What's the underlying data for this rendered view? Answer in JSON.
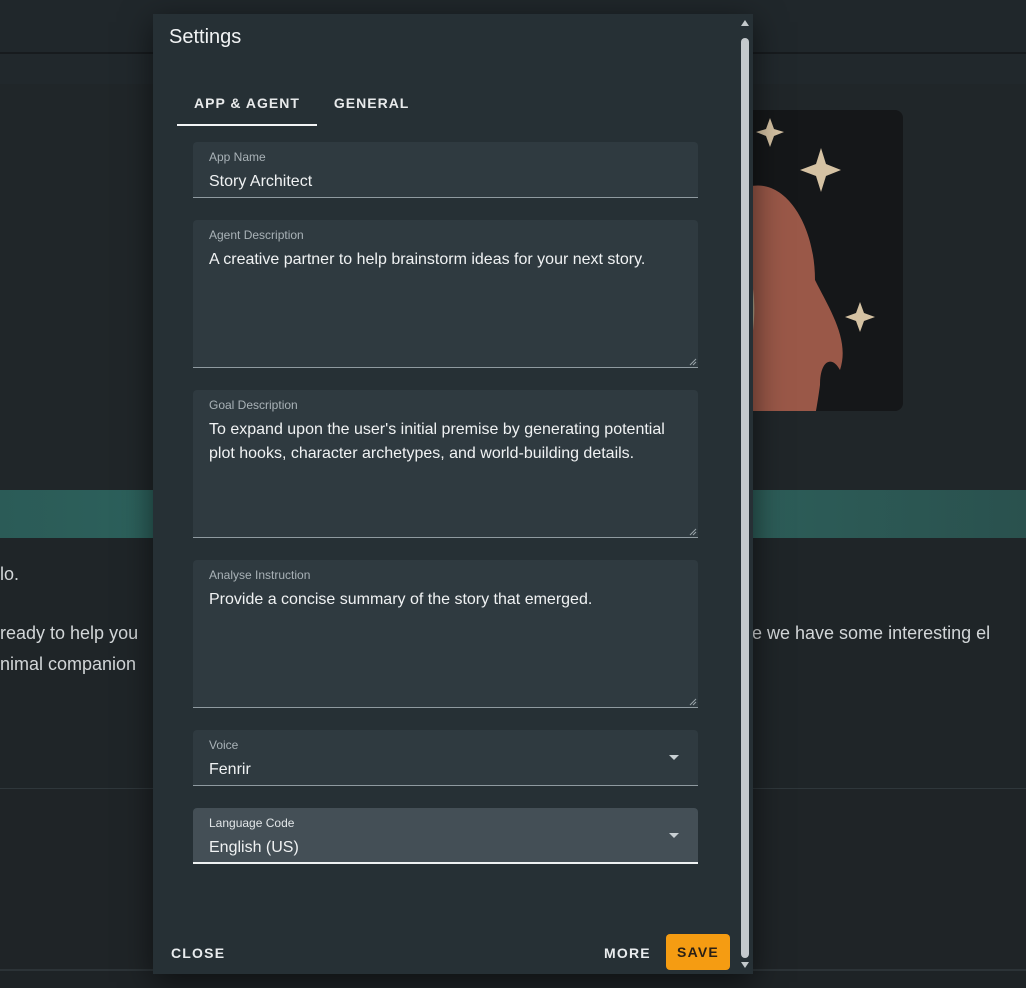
{
  "background": {
    "chat_line_1": "lo.",
    "chat_line_2_left": "ready to help you",
    "chat_line_2_right": "e we have some interesting el",
    "chat_line_3_left": "nimal companion"
  },
  "dialog": {
    "title": "Settings",
    "tabs": [
      {
        "label": "APP & AGENT",
        "active": true
      },
      {
        "label": "GENERAL",
        "active": false
      }
    ],
    "fields": {
      "app_name": {
        "label": "App Name",
        "value": "Story Architect"
      },
      "agent_description": {
        "label": "Agent Description",
        "value": "A creative partner to help brainstorm ideas for your next story."
      },
      "goal_description": {
        "label": "Goal Description",
        "value": "To expand upon the user's initial premise by generating potential plot hooks, character archetypes, and world-building details."
      },
      "analyse_instruction": {
        "label": "Analyse Instruction",
        "value": "Provide a concise summary of the story that emerged."
      },
      "voice": {
        "label": "Voice",
        "value": "Fenrir"
      },
      "language_code": {
        "label": "Language Code",
        "value": "English (US)"
      }
    },
    "buttons": {
      "close": "CLOSE",
      "more": "MORE",
      "save": "SAVE"
    }
  },
  "colors": {
    "accent": "#f59c12",
    "dialog_bg": "#263035",
    "banner": "#2f6a63"
  },
  "icons": [
    "dropdown-caret-icon",
    "sparkle-icon",
    "resize-handle-icon",
    "scroll-arrow-icon"
  ]
}
